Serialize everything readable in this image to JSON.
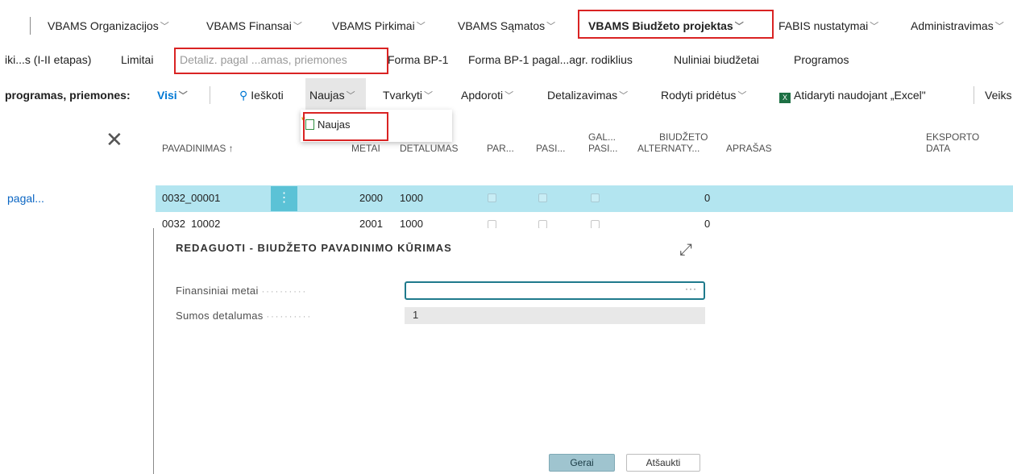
{
  "nav_main": {
    "items": [
      "VBAMS Organizacijos",
      "VBAMS Finansai",
      "VBAMS Pirkimai",
      "VBAMS Sąmatos",
      "VBAMS Biudžeto projektas",
      "FABIS nustatymai",
      "Administravimas"
    ]
  },
  "nav_sub": {
    "items": [
      "iki...s (I-II etapas)",
      "Limitai",
      "Detaliz. pagal ...amas, priemones",
      "Forma BP-1",
      "Forma BP-1 pagal...agr. rodiklius",
      "Nuliniai biudžetai",
      "Programos"
    ]
  },
  "toolbar": {
    "filter_label": "programas, priemones:",
    "filter_value": "Visi",
    "search": "Ieškoti",
    "new": "Naujas",
    "manage": "Tvarkyti",
    "process": "Apdoroti",
    "detail": "Detalizavimas",
    "show_attached": "Rodyti pridėtus",
    "excel": "Atidaryti naudojant „Excel\"",
    "actions": "Veiks"
  },
  "dropdown": {
    "item": "Naujas"
  },
  "columns": {
    "name": "PAVADINIMAS ↑",
    "year": "METAI",
    "detail": "DETALUMAS",
    "par": "PAR...",
    "pasi": "PASI...",
    "gal1": "GAL...",
    "gal2": "PASI...",
    "alt1": "BIUDŽETO",
    "alt2": "ALTERNATY...",
    "desc": "APRAŠAS",
    "exp1": "EKSPORTO",
    "exp2": "DATA"
  },
  "left_panel": {
    "items": [
      "pagal...",
      "pagal..."
    ]
  },
  "rows": [
    {
      "name": "0032_00001",
      "year": "2000",
      "detail": "1000",
      "alt": "0"
    },
    {
      "name": "0032_10002",
      "year": "2001",
      "detail": "1000",
      "alt": "0"
    }
  ],
  "dialog": {
    "title": "REDAGUOTI - BIUDŽETO PAVADINIMO KŪRIMAS",
    "field1_label": "Finansiniai metai",
    "field1_value": "",
    "field2_label": "Sumos detalumas",
    "field2_value": "1",
    "ok": "Gerai",
    "cancel": "Atšaukti"
  },
  "colors": {
    "accent": "#0078d4",
    "highlight_row": "#b3e5f0",
    "red_outline": "#d92323"
  }
}
